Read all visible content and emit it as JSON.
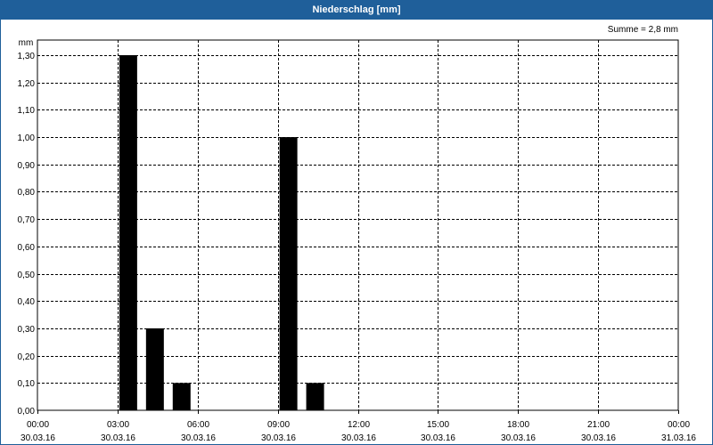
{
  "window": {
    "title": "Niederschlag [mm]"
  },
  "summary": {
    "text": "Summe = 2,8 mm"
  },
  "colors": {
    "title_bar": "#1f5f9a",
    "bar_fill": "#000000",
    "grid": "#000000",
    "background": "#ffffff"
  },
  "chart_data": {
    "type": "bar",
    "title": "Niederschlag [mm]",
    "ylabel": "mm",
    "xlabel": "",
    "ylim": [
      0,
      1.3
    ],
    "yticks": [
      "0,00",
      "0,10",
      "0,20",
      "0,30",
      "0,40",
      "0,50",
      "0,60",
      "0,70",
      "0,80",
      "0,90",
      "1,00",
      "1,10",
      "1,20",
      "1,30"
    ],
    "xlim_hours": [
      0,
      24
    ],
    "xticks": [
      {
        "time": "00:00",
        "date": "30.03.16"
      },
      {
        "time": "03:00",
        "date": "30.03.16"
      },
      {
        "time": "06:00",
        "date": "30.03.16"
      },
      {
        "time": "09:00",
        "date": "30.03.16"
      },
      {
        "time": "12:00",
        "date": "30.03.16"
      },
      {
        "time": "15:00",
        "date": "30.03.16"
      },
      {
        "time": "18:00",
        "date": "30.03.16"
      },
      {
        "time": "21:00",
        "date": "30.03.16"
      },
      {
        "time": "00:00",
        "date": "31.03.16"
      }
    ],
    "grid": true,
    "bars": [
      {
        "hour": 3,
        "value": 1.3
      },
      {
        "hour": 4,
        "value": 0.3
      },
      {
        "hour": 5,
        "value": 0.1
      },
      {
        "hour": 9,
        "value": 1.0
      },
      {
        "hour": 10,
        "value": 0.1
      }
    ]
  }
}
